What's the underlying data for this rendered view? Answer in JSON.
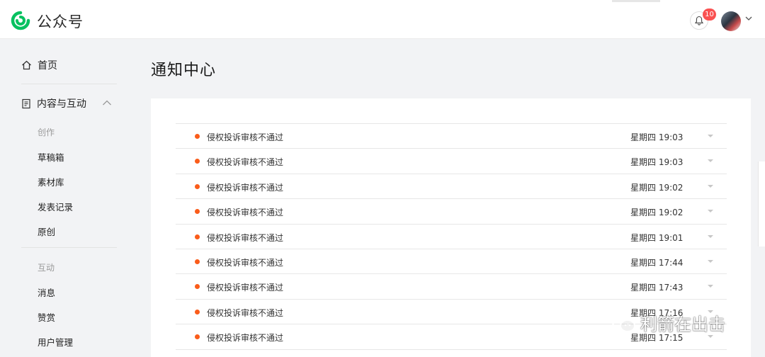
{
  "header": {
    "brand": "公众号",
    "notification_count": "10",
    "brand_color": "#07c160",
    "badge_color": "#fa5151"
  },
  "sidebar": {
    "home": "首页",
    "section": "内容与互动",
    "groups": [
      {
        "label": "创作",
        "items": [
          "草稿箱",
          "素材库",
          "发表记录",
          "原创"
        ]
      },
      {
        "label": "互动",
        "items": [
          "消息",
          "赞赏",
          "用户管理"
        ]
      }
    ]
  },
  "main": {
    "title": "通知中心",
    "notifications": [
      {
        "title": "侵权投诉审核不通过",
        "time": "星期四 19:03"
      },
      {
        "title": "侵权投诉审核不通过",
        "time": "星期四 19:03"
      },
      {
        "title": "侵权投诉审核不通过",
        "time": "星期四 19:02"
      },
      {
        "title": "侵权投诉审核不通过",
        "time": "星期四 19:02"
      },
      {
        "title": "侵权投诉审核不通过",
        "time": "星期四 19:01"
      },
      {
        "title": "侵权投诉审核不通过",
        "time": "星期四 17:44"
      },
      {
        "title": "侵权投诉审核不通过",
        "time": "星期四 17:43"
      },
      {
        "title": "侵权投诉审核不通过",
        "time": "星期四 17:16"
      },
      {
        "title": "侵权投诉审核不通过",
        "time": "星期四 17:15"
      }
    ],
    "unread_dot_color": "#fa5c1a"
  },
  "watermark": "利箭在出击"
}
